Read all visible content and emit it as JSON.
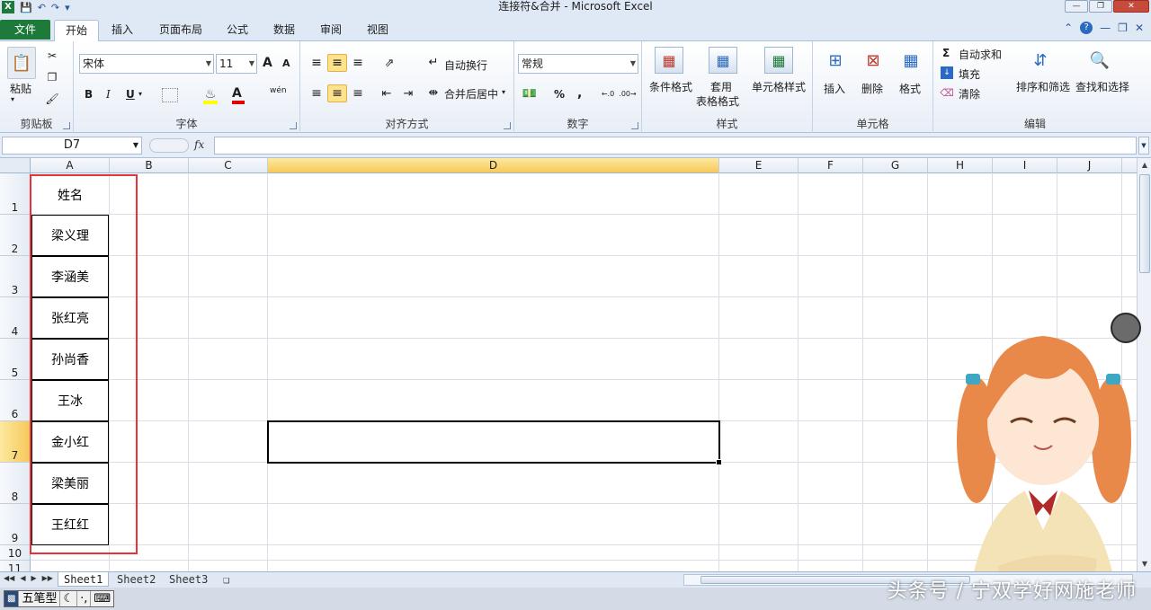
{
  "window": {
    "title": "连接符&合并 - Microsoft Excel",
    "xl_icon": "X"
  },
  "tabs": [
    {
      "label": "文件"
    },
    {
      "label": "开始"
    },
    {
      "label": "插入"
    },
    {
      "label": "页面布局"
    },
    {
      "label": "公式"
    },
    {
      "label": "数据"
    },
    {
      "label": "审阅"
    },
    {
      "label": "视图"
    }
  ],
  "ribbon": {
    "clipboard": {
      "label": "剪贴板",
      "paste": "粘贴"
    },
    "font": {
      "label": "字体",
      "name": "宋体",
      "size": "11",
      "bold": "B",
      "italic": "I",
      "underline": "U",
      "grow": "A",
      "shrink": "A",
      "color_a": "A",
      "wen": "wén"
    },
    "align": {
      "label": "对齐方式",
      "wrap": "自动换行",
      "merge": "合并后居中"
    },
    "number": {
      "label": "数字",
      "format": "常规",
      "percent": "%",
      "comma": ",",
      "inc": "+.0\n.00",
      "dec": ".00\n+.0"
    },
    "styles": {
      "label": "样式",
      "conditional": "条件格式",
      "table_1": "套用",
      "table_2": "表格格式",
      "cell_style": "单元格样式"
    },
    "cells": {
      "label": "单元格",
      "insert": "插入",
      "delete": "删除",
      "format": "格式"
    },
    "editing": {
      "label": "编辑",
      "autosum": "自动求和",
      "fill": "填充",
      "clear": "清除",
      "sort": "排序和筛选",
      "find": "查找和选择",
      "sigma": "Σ"
    }
  },
  "formula_bar": {
    "name_box": "D7",
    "fx": "fx",
    "value": ""
  },
  "columns": [
    "A",
    "B",
    "C",
    "D",
    "E",
    "F",
    "G",
    "H",
    "I",
    "J"
  ],
  "rows": [
    "1",
    "2",
    "3",
    "4",
    "5",
    "6",
    "7",
    "8",
    "9",
    "10",
    "11"
  ],
  "cells_a": [
    "姓名",
    "梁义理",
    "李涵美",
    "张红亮",
    "孙尚香",
    "王冰",
    "金小红",
    "梁美丽",
    "王红红"
  ],
  "sheets": [
    "Sheet1",
    "Sheet2",
    "Sheet3"
  ],
  "ime": {
    "mode": "五笔型"
  },
  "watermark": "头条号 / 宁双学好网施老师"
}
